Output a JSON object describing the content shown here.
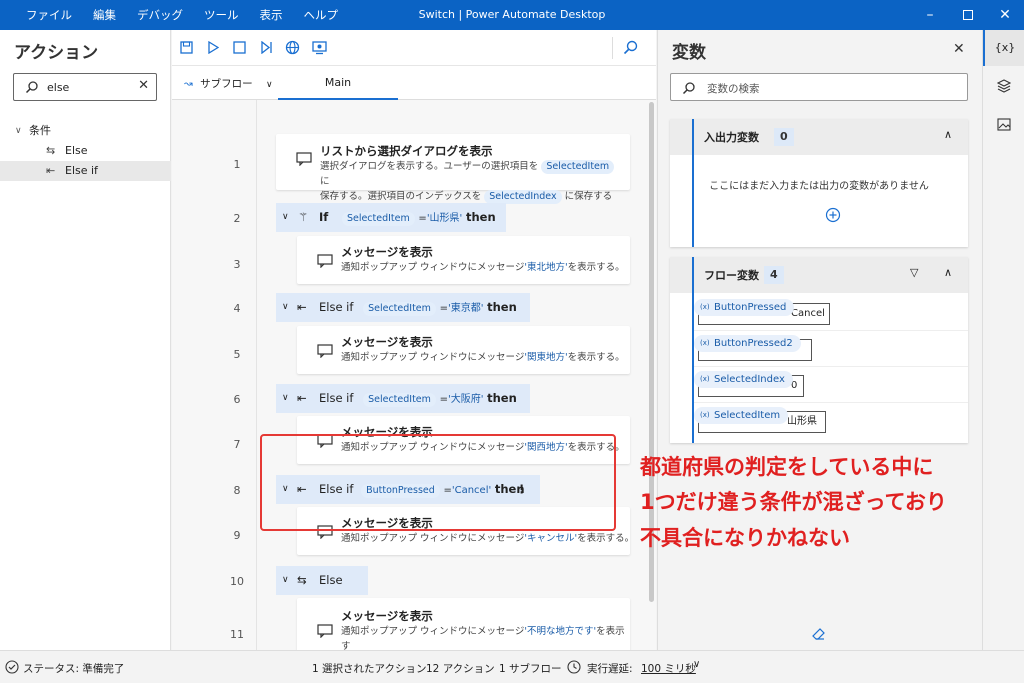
{
  "window": {
    "title": "Switch | Power Automate Desktop",
    "menu": [
      "ファイル",
      "編集",
      "デバッグ",
      "ツール",
      "表示",
      "ヘルプ"
    ]
  },
  "actions": {
    "title": "アクション",
    "search_value": "else",
    "tree": {
      "category": "条件",
      "items": [
        "Else",
        "Else if"
      ]
    }
  },
  "editor": {
    "subflow_label": "サブフロー",
    "tab": "Main"
  },
  "flow": [
    {
      "line": "1",
      "title": "リストから選択ダイアログを表示",
      "d1a": "選択ダイアログを表示する。ユーザーの選択項目を",
      "var1": "SelectedItem",
      "d1b": "に",
      "d2a": "保存する。選択項目のインデックスを",
      "var2": "SelectedIndex",
      "d2b": "に保存する"
    },
    {
      "line": "2",
      "kw": "If",
      "var": "SelectedItem",
      "op": "=",
      "val": "'山形県'",
      "then": "then"
    },
    {
      "line": "3",
      "title": "メッセージを表示",
      "pre": "通知ポップアップ ウィンドウにメッセージ",
      "val": "'東北地方'",
      "post": "を表示する。"
    },
    {
      "line": "4",
      "kw": "Else if",
      "var": "SelectedItem",
      "op": "=",
      "val": "'東京都'",
      "then": "then"
    },
    {
      "line": "5",
      "title": "メッセージを表示",
      "pre": "通知ポップアップ ウィンドウにメッセージ",
      "val": "'関東地方'",
      "post": "を表示する。"
    },
    {
      "line": "6",
      "kw": "Else if",
      "var": "SelectedItem",
      "op": "=",
      "val": "'大阪府'",
      "then": "then"
    },
    {
      "line": "7",
      "title": "メッセージを表示",
      "pre": "通知ポップアップ ウィンドウにメッセージ",
      "val": "'関西地方'",
      "post": "を表示する。"
    },
    {
      "line": "8",
      "kw": "Else if",
      "var": "ButtonPressed",
      "op": "=",
      "val": "'Cancel'",
      "then": "then"
    },
    {
      "line": "9",
      "title": "メッセージを表示",
      "pre": "通知ポップアップ ウィンドウにメッセージ",
      "val": "'キャンセル'",
      "post": "を表示する。"
    },
    {
      "line": "10",
      "kw": "Else"
    },
    {
      "line": "11",
      "title": "メッセージを表示",
      "pre": "通知ポップアップ ウィンドウにメッセージ",
      "val": "'不明な地方です'",
      "post": "を表示す",
      "post2": "る。"
    }
  ],
  "variables": {
    "title": "変数",
    "search_placeholder": "変数の検索",
    "io": {
      "label": "入出力変数",
      "count": "0",
      "empty": "ここにはまだ入力または出力の変数がありません"
    },
    "flow": {
      "label": "フロー変数",
      "count": "4",
      "items": [
        {
          "name": "ButtonPressed",
          "value": "Cancel"
        },
        {
          "name": "ButtonPressed2",
          "value": ""
        },
        {
          "name": "SelectedIndex",
          "value": "0"
        },
        {
          "name": "SelectedItem",
          "value": "山形県"
        }
      ]
    },
    "var_prefix": "(x)"
  },
  "side_icons": {
    "vars": "{x}"
  },
  "status": {
    "state": "ステータス: 準備完了",
    "selected": "1 選択されたアクション",
    "actions": "12 アクション",
    "subflows": "1 サブフロー",
    "delay_label": "実行遅延:",
    "delay_value": "100 ミリ秒"
  },
  "annotation": {
    "lines": [
      "都道府県の判定をしている中に",
      "1つだけ違う条件が混ざっており",
      "不具合になりかねない"
    ],
    "color": "#e02020"
  }
}
